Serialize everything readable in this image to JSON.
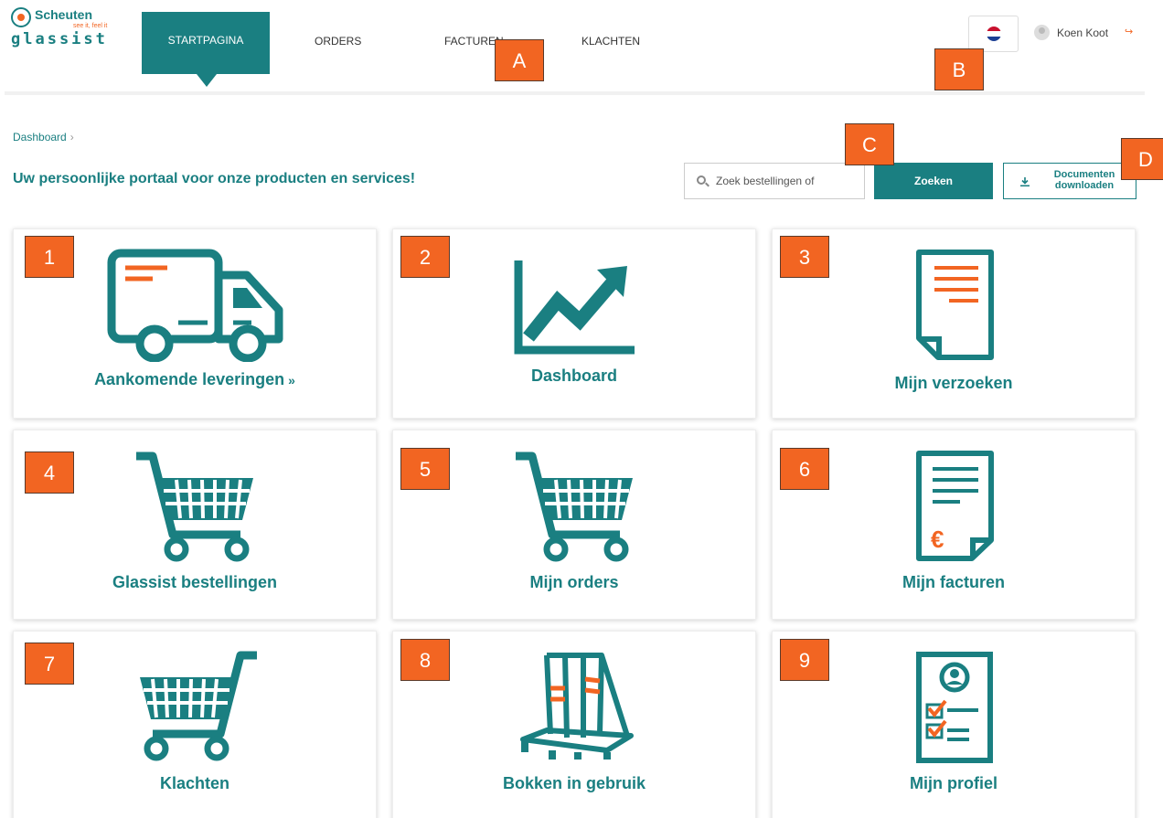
{
  "brand": {
    "name": "Scheuten",
    "tagline": "see it, feel it",
    "product": "glassist"
  },
  "nav": {
    "items": [
      {
        "label": "STARTPAGINA",
        "active": true
      },
      {
        "label": "ORDERS",
        "active": false
      },
      {
        "label": "FACTUREN",
        "active": false
      },
      {
        "label": "KLACHTEN",
        "active": false
      }
    ]
  },
  "user": {
    "name": "Koen Koot",
    "language_flag": "flag-nl-icon"
  },
  "breadcrumb": {
    "items": [
      "Dashboard"
    ]
  },
  "page": {
    "title": "Uw persoonlijke portaal voor onze producten en services!"
  },
  "search": {
    "placeholder": "Zoek bestellingen of",
    "button_label": "Zoeken"
  },
  "downloads": {
    "label_line1": "Documenten",
    "label_line2": "downloaden"
  },
  "cards": [
    {
      "label": "Aankomende leveringen",
      "icon": "delivery-truck-icon",
      "marker": "1"
    },
    {
      "label": "Dashboard",
      "icon": "trend-chart-icon",
      "marker": "2"
    },
    {
      "label": "Mijn verzoeken",
      "icon": "document-icon",
      "marker": "3"
    },
    {
      "label": "Glassist bestellingen",
      "icon": "shopping-cart-icon",
      "marker": "4"
    },
    {
      "label": "Mijn orders",
      "icon": "shopping-cart-icon",
      "marker": "5"
    },
    {
      "label": "Mijn facturen",
      "icon": "invoice-icon",
      "marker": "6"
    },
    {
      "label": "Klachten",
      "icon": "shopping-cart-icon",
      "marker": "7"
    },
    {
      "label": "Bokken in gebruik",
      "icon": "glass-rack-icon",
      "marker": "8"
    },
    {
      "label": "Mijn profiel",
      "icon": "profile-document-icon",
      "marker": "9"
    }
  ],
  "markers": {
    "a": "A",
    "b": "B",
    "c": "C",
    "d": "D"
  },
  "colors": {
    "brand_teal": "#1a7f81",
    "accent_orange": "#f26522",
    "marker_orange": "#f26522"
  }
}
